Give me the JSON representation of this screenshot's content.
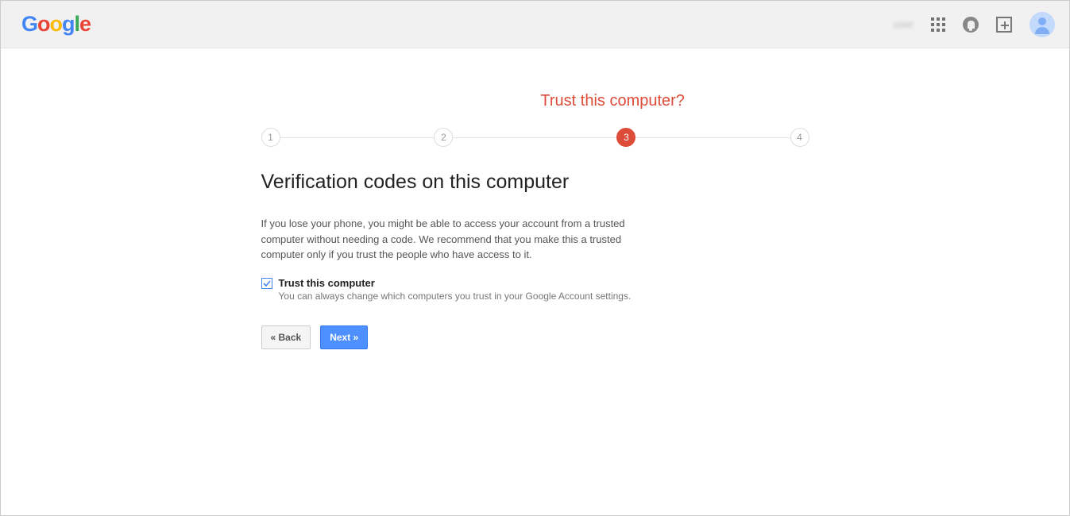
{
  "header": {
    "logo_text": "Google",
    "user_blur": "user"
  },
  "stepper": {
    "title": "Trust this computer?",
    "steps": [
      "1",
      "2",
      "3",
      "4"
    ],
    "active_index": 2
  },
  "main": {
    "heading": "Verification codes on this computer",
    "description": "If you lose your phone, you might be able to access your account from a trusted computer without needing a code. We recommend that you make this a trusted computer only if you trust the people who have access to it.",
    "checkbox": {
      "checked": true,
      "label": "Trust this computer",
      "sublabel": "You can always change which computers you trust in your Google Account settings."
    },
    "buttons": {
      "back": "« Back",
      "next": "Next »"
    }
  }
}
